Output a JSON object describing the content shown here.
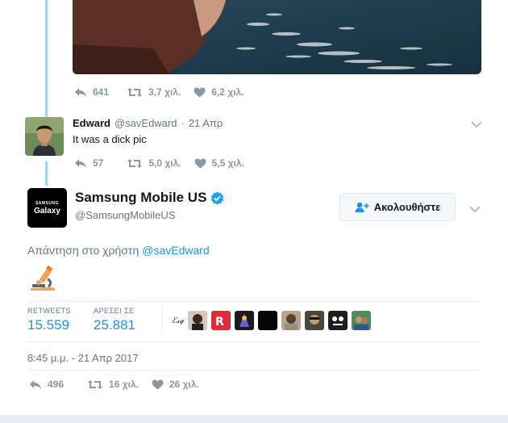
{
  "previous_tweet": {
    "actions": {
      "replies": "641",
      "retweets": "3,7 χιλ.",
      "likes": "6,2 χιλ."
    }
  },
  "reply_tweet": {
    "name": "Edward",
    "handle": "@savEdward",
    "separator": "·",
    "date": "21 Απρ",
    "text": "It was a dick pic",
    "actions": {
      "replies": "57",
      "retweets": "5,0 χιλ.",
      "likes": "5,5 χιλ."
    }
  },
  "main_tweet": {
    "avatar_brand": "SAMSUNG",
    "avatar_product": "Galaxy",
    "name": "Samsung Mobile US",
    "handle": "@SamsungMobileUS",
    "follow_label": "Ακολουθήστε",
    "reply_prefix": "Απάντηση στο χρήστη",
    "reply_mention": "@savEdward",
    "emoji": "microscope-emoji",
    "stats": {
      "retweets_label": "RETWEETS",
      "retweets_value": "15.559",
      "likes_label": "ΑΡΕΣΕΙ ΣΕ",
      "likes_value": "25.881"
    },
    "liker_first_label": "ℰ𝓈𝓆",
    "timestamp": "8:45 μ.μ. - 21 Απρ 2017",
    "actions": {
      "replies": "496",
      "retweets": "16 χιλ.",
      "likes": "26 χιλ."
    }
  },
  "colors": {
    "link": "#1b95e0",
    "muted": "#8899a6",
    "verified": "#1da1f2",
    "thread_line": "#a7d7ea"
  }
}
